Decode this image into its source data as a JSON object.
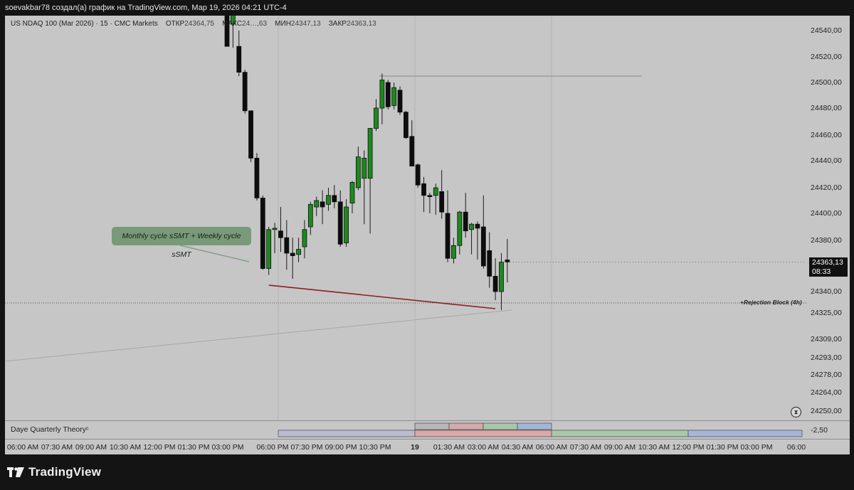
{
  "header": {
    "attribution": "soevakbar78 создал(а) график на TradingView.com, Мар 19, 2026 04:21 UTC-4"
  },
  "legend": {
    "symbol": "US NDAQ 100 (Mar 2026) · 15 · CMC Markets",
    "open_label": "ОТКР",
    "open": "24364,75",
    "high_label": "МАКС",
    "high": "24…,63",
    "low_label": "МИН",
    "low": "24347,13",
    "close_label": "ЗАКР",
    "close": "24363,13"
  },
  "price_axis": {
    "ticks": [
      "24540,00",
      "24520,00",
      "24500,00",
      "24480,00",
      "24460,00",
      "24440,00",
      "24420,00",
      "24400,00",
      "24380,00",
      "24340,00",
      "24325,00",
      "24309,00",
      "24293,00",
      "24278,00",
      "24264,00",
      "24250,00"
    ],
    "last_price": "24363,13",
    "countdown": "08:33"
  },
  "annotations": {
    "callout": "Monthly cycle sSMT + Weekly cycle sSMT",
    "rejection_block": "+Rejection Block (4h)"
  },
  "indicator": {
    "title": "Daye Quarterly Theory",
    "title_suffix": "ᶜ",
    "value": "-2,50"
  },
  "time_axis": {
    "labels": [
      "06:00 AM",
      "07:30 AM",
      "09:00 AM",
      "10:30 AM",
      "12:00 PM",
      "01:30 PM",
      "03:00 PM",
      "06:00 PM",
      "07:30 PM",
      "09:00 PM",
      "10:30 PM",
      "19",
      "01:30 AM",
      "03:00 AM",
      "04:30 AM",
      "06:00 AM",
      "07:30 AM",
      "09:00 AM",
      "10:30 AM",
      "12:00 PM",
      "01:30 PM",
      "03:00 PM",
      "06:00"
    ]
  },
  "branding": {
    "name": "TradingView"
  },
  "colors": {
    "up": "#1c8a1c",
    "down": "#0d0d0d",
    "background": "#c6c6c6",
    "callout": "#789a78",
    "trendline": "#8b1e1e"
  },
  "chart_data": {
    "type": "candlestick",
    "title": "US NDAQ 100 (Mar 2026) · 15 · CMC Markets",
    "y_range": [
      24244,
      24553
    ],
    "scale": "nonlinear",
    "candles": [
      {
        "o": 24560,
        "h": 24565,
        "l": 24528,
        "c": 24528
      },
      {
        "o": 24545,
        "h": 24560,
        "l": 24527,
        "c": 24555
      },
      {
        "o": 24528,
        "h": 24540,
        "l": 24505,
        "c": 24508
      },
      {
        "o": 24508,
        "h": 24510,
        "l": 24476,
        "c": 24478
      },
      {
        "o": 24478,
        "h": 24478,
        "l": 24439,
        "c": 24442
      },
      {
        "o": 24442,
        "h": 24446,
        "l": 24410,
        "c": 24412
      },
      {
        "o": 24412,
        "h": 24414,
        "l": 24357,
        "c": 24358
      },
      {
        "o": 24358,
        "h": 24390,
        "l": 24353,
        "c": 24388
      },
      {
        "o": 24388,
        "h": 24393,
        "l": 24370,
        "c": 24389
      },
      {
        "o": 24387,
        "h": 24405,
        "l": 24371,
        "c": 24382
      },
      {
        "o": 24382,
        "h": 24395,
        "l": 24357,
        "c": 24370
      },
      {
        "o": 24370,
        "h": 24382,
        "l": 24350,
        "c": 24368
      },
      {
        "o": 24369,
        "h": 24382,
        "l": 24363,
        "c": 24373
      },
      {
        "o": 24375,
        "h": 24395,
        "l": 24366,
        "c": 24388
      },
      {
        "o": 24390,
        "h": 24409,
        "l": 24384,
        "c": 24407
      },
      {
        "o": 24405,
        "h": 24413,
        "l": 24398,
        "c": 24410
      },
      {
        "o": 24409,
        "h": 24418,
        "l": 24392,
        "c": 24405
      },
      {
        "o": 24407,
        "h": 24420,
        "l": 24402,
        "c": 24414
      },
      {
        "o": 24414,
        "h": 24422,
        "l": 24404,
        "c": 24409
      },
      {
        "o": 24409,
        "h": 24418,
        "l": 24375,
        "c": 24377
      },
      {
        "o": 24378,
        "h": 24411,
        "l": 24375,
        "c": 24405
      },
      {
        "o": 24408,
        "h": 24425,
        "l": 24400,
        "c": 24424
      },
      {
        "o": 24420,
        "h": 24451,
        "l": 24418,
        "c": 24443
      },
      {
        "o": 24427,
        "h": 24448,
        "l": 24392,
        "c": 24442
      },
      {
        "o": 24427,
        "h": 24462,
        "l": 24385,
        "c": 24465
      },
      {
        "o": 24465,
        "h": 24487,
        "l": 24463,
        "c": 24480
      },
      {
        "o": 24480,
        "h": 24507,
        "l": 24468,
        "c": 24502
      },
      {
        "o": 24500,
        "h": 24502,
        "l": 24479,
        "c": 24481
      },
      {
        "o": 24482,
        "h": 24500,
        "l": 24479,
        "c": 24496
      },
      {
        "o": 24494,
        "h": 24497,
        "l": 24475,
        "c": 24477
      },
      {
        "o": 24477,
        "h": 24478,
        "l": 24457,
        "c": 24458
      },
      {
        "o": 24459,
        "h": 24471,
        "l": 24436,
        "c": 24436
      },
      {
        "o": 24437,
        "h": 24438,
        "l": 24420,
        "c": 24422
      },
      {
        "o": 24423,
        "h": 24428,
        "l": 24401,
        "c": 24414
      },
      {
        "o": 24414,
        "h": 24416,
        "l": 24400,
        "c": 24413
      },
      {
        "o": 24414,
        "h": 24423,
        "l": 24399,
        "c": 24420
      },
      {
        "o": 24417,
        "h": 24433,
        "l": 24396,
        "c": 24401
      },
      {
        "o": 24400,
        "h": 24418,
        "l": 24363,
        "c": 24366
      },
      {
        "o": 24366,
        "h": 24382,
        "l": 24362,
        "c": 24376
      },
      {
        "o": 24376,
        "h": 24402,
        "l": 24369,
        "c": 24401
      },
      {
        "o": 24401,
        "h": 24416,
        "l": 24382,
        "c": 24387
      },
      {
        "o": 24388,
        "h": 24393,
        "l": 24369,
        "c": 24392
      },
      {
        "o": 24392,
        "h": 24394,
        "l": 24365,
        "c": 24389
      },
      {
        "o": 24390,
        "h": 24414,
        "l": 24358,
        "c": 24360
      },
      {
        "o": 24372,
        "h": 24386,
        "l": 24343,
        "c": 24352
      },
      {
        "o": 24352,
        "h": 24366,
        "l": 24334,
        "c": 24340
      },
      {
        "o": 24340,
        "h": 24370,
        "l": 24327,
        "c": 24363
      },
      {
        "o": 24364.75,
        "h": 24381,
        "l": 24347.13,
        "c": 24363.13
      }
    ],
    "horizontal_lines": [
      {
        "y": 24505,
        "label": ""
      },
      {
        "y": 24332,
        "label": "+Rejection Block (4h)"
      }
    ],
    "trendlines": [
      {
        "from": [
          7,
          24345
        ],
        "to": [
          45,
          24328
        ],
        "color": "#8b1e1e"
      }
    ]
  }
}
